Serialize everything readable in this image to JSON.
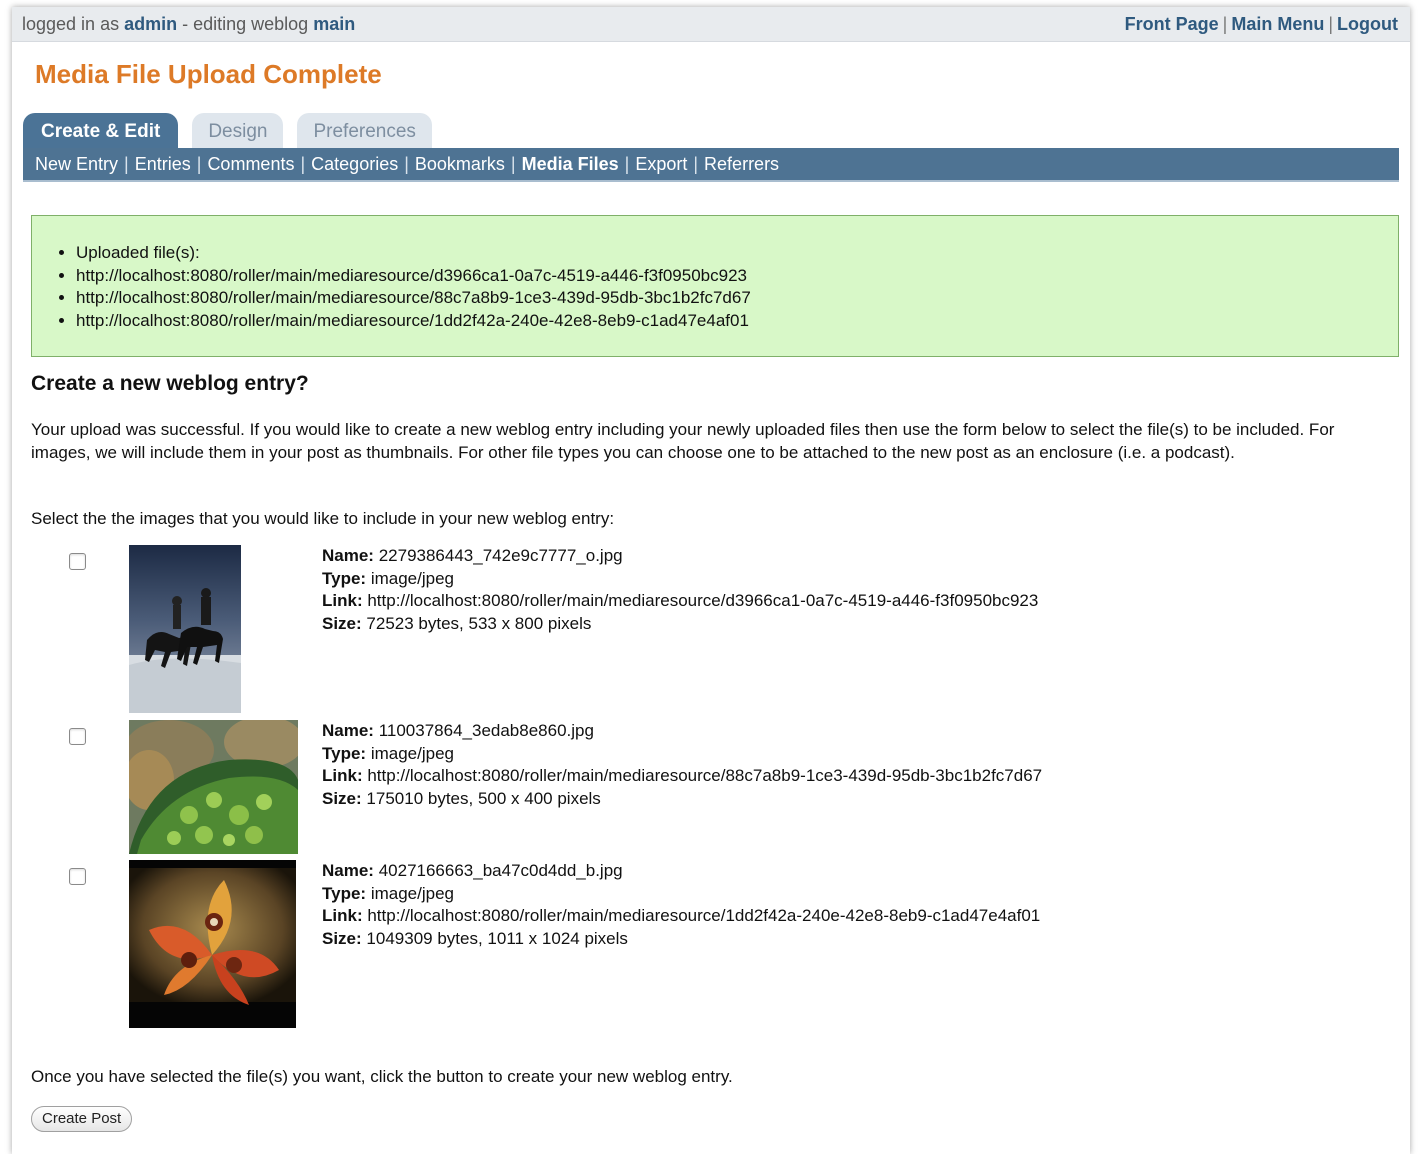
{
  "topbar": {
    "prefix": "logged in as ",
    "user": "admin",
    "middle": " - editing weblog ",
    "weblog": "main",
    "links": [
      "Front Page",
      "Main Menu",
      "Logout"
    ]
  },
  "page_title": "Media File Upload Complete",
  "tabs": [
    {
      "label": "Create & Edit",
      "active": true
    },
    {
      "label": "Design",
      "active": false
    },
    {
      "label": "Preferences",
      "active": false
    }
  ],
  "subnav": [
    {
      "label": "New Entry",
      "selected": false
    },
    {
      "label": "Entries",
      "selected": false
    },
    {
      "label": "Comments",
      "selected": false
    },
    {
      "label": "Categories",
      "selected": false
    },
    {
      "label": "Bookmarks",
      "selected": false
    },
    {
      "label": "Media Files",
      "selected": true
    },
    {
      "label": "Export",
      "selected": false
    },
    {
      "label": "Referrers",
      "selected": false
    }
  ],
  "message": {
    "items": [
      "Uploaded file(s):",
      "http://localhost:8080/roller/main/mediaresource/d3966ca1-0a7c-4519-a446-f3f0950bc923",
      "http://localhost:8080/roller/main/mediaresource/88c7a8b9-1ce3-439d-95db-3bc1b2fc7d67",
      "http://localhost:8080/roller/main/mediaresource/1dd2f42a-240e-42e8-8eb9-c1ad47e4af01"
    ]
  },
  "subheading": "Create a new weblog entry?",
  "intro": "Your upload was successful. If you would like to create a new weblog entry including your newly uploaded files then use the form below to select the file(s) to be included. For images, we will include them in your post as thumbnails. For other file types you can choose one to be attached to the new post as an enclosure (i.e. a podcast).",
  "select_prompt": "Select the the images that you would like to include in your new weblog entry:",
  "labels": {
    "name": "Name:",
    "type": "Type:",
    "link": "Link:",
    "size": "Size:"
  },
  "files": [
    {
      "name": "2279386443_742e9c7777_o.jpg",
      "type": "image/jpeg",
      "link": "http://localhost:8080/roller/main/mediaresource/d3966ca1-0a7c-4519-a446-f3f0950bc923",
      "size": "72523 bytes, 533 x 800 pixels",
      "checked": false
    },
    {
      "name": "110037864_3edab8e860.jpg",
      "type": "image/jpeg",
      "link": "http://localhost:8080/roller/main/mediaresource/88c7a8b9-1ce3-439d-95db-3bc1b2fc7d67",
      "size": "175010 bytes, 500 x 400 pixels",
      "checked": false
    },
    {
      "name": "4027166663_ba47c0d4dd_b.jpg",
      "type": "image/jpeg",
      "link": "http://localhost:8080/roller/main/mediaresource/1dd2f42a-240e-42e8-8eb9-c1ad47e4af01",
      "size": "1049309 bytes, 1011 x 1024 pixels",
      "checked": false
    }
  ],
  "footer_text": "Once you have selected the file(s) you want, click the button to create your new weblog entry.",
  "create_button": "Create Post",
  "colors": {
    "title": "#dd7a27",
    "nav": "#4e7393",
    "message_bg": "#d8f8c8",
    "link": "#2f5a7f"
  }
}
